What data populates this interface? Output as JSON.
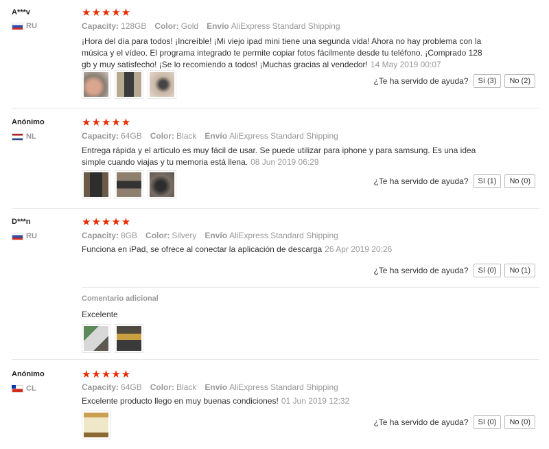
{
  "help_question": "¿Te ha servido de ayuda?",
  "stars": "★★★★★",
  "labels": {
    "capacity": "Capacity:",
    "color": "Color:",
    "shipping": "Envío"
  },
  "reviews": [
    {
      "user": "A***v",
      "country": "RU",
      "capacity": "128GB",
      "color": "Gold",
      "shipping": "AliExpress Standard Shipping",
      "text": "¡Hora del día para todos! ¡Increíble! ¡Mi viejo ipad mini tiene una segunda vida! Ahora no hay problema con la música y el vídeo. El programa integrado te permite copiar fotos fácilmente desde tu teléfono. ¡Comprado 128 gb y muy satisfecho! ¡Se lo recomiendo a todos! ¡Muchas gracias al vendedor!",
      "date": "14 May 2019 00:07",
      "yes": "Sí (3)",
      "no": "No (2)"
    },
    {
      "user": "Anónimo",
      "country": "NL",
      "capacity": "64GB",
      "color": "Black",
      "shipping": "AliExpress Standard Shipping",
      "text": "Entrega rápida y el artículo es muy fácil de usar. Se puede utilizar para iphone y para samsung. Es una idea simple cuando viajas y tu memoria está llena.",
      "date": "08 Jun 2019 06:29",
      "yes": "Sí (1)",
      "no": "No (0)"
    },
    {
      "user": "D***n",
      "country": "RU",
      "capacity": "8GB",
      "color": "Silvery",
      "shipping": "AliExpress Standard Shipping",
      "text": "Funciona en iPad, se ofrece al conectar la aplicación de descarga",
      "date": "26 Apr 2019 20:26",
      "yes": "Sí (0)",
      "no": "No (1)",
      "additional_label": "Comentario adicional",
      "additional_text": "Excelente"
    },
    {
      "user": "Anónimo",
      "country": "CL",
      "capacity": "64GB",
      "color": "Black",
      "shipping": "AliExpress Standard Shipping",
      "text": "Excelente producto llego en muy buenas condiciones!",
      "date": "01 Jun 2019 12:32",
      "yes": "Sí (0)",
      "no": "No (0)"
    }
  ]
}
